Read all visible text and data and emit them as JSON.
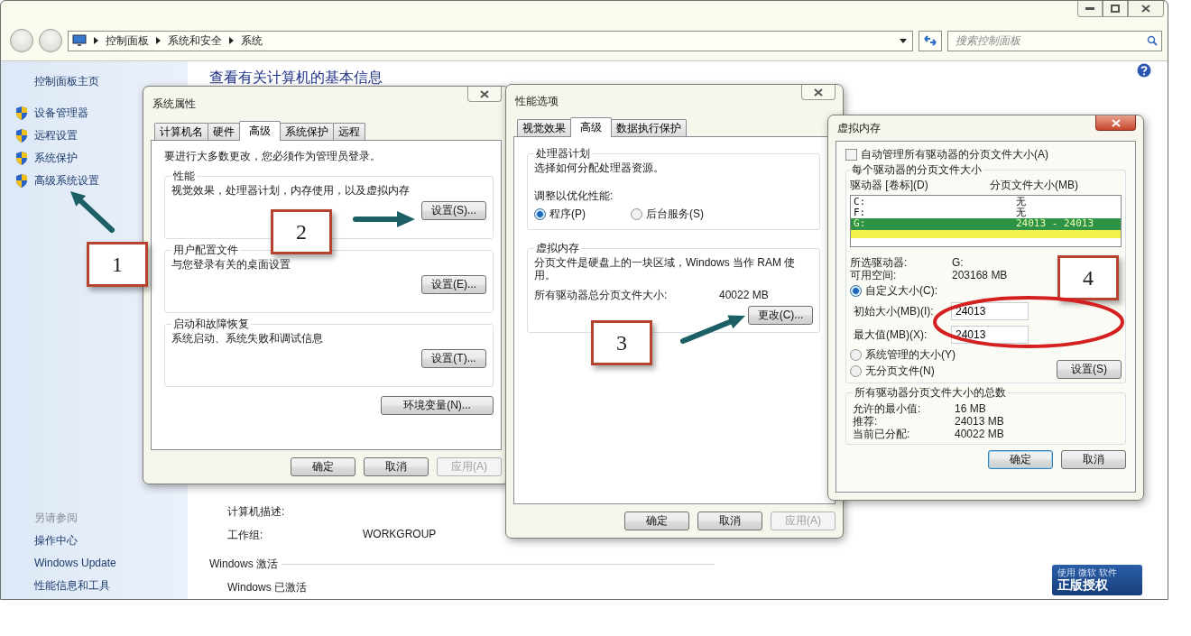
{
  "window": {
    "breadcrumbs": [
      "控制面板",
      "系统和安全",
      "系统"
    ],
    "search": {
      "placeholder": "搜索控制面板"
    }
  },
  "sidebar": {
    "home": "控制面板主页",
    "tasks": [
      "设备管理器",
      "远程设置",
      "系统保护",
      "高级系统设置"
    ],
    "see_also_title": "另请参阅",
    "see_also": [
      "操作中心",
      "Windows Update",
      "性能信息和工具"
    ]
  },
  "content": {
    "heading": "查看有关计算机的基本信息",
    "details": [
      {
        "label": "计算机描述:"
      },
      {
        "label": "工作组:",
        "value": "WORKGROUP"
      }
    ],
    "activation": {
      "title": "Windows 激活",
      "status": "Windows 已激活"
    },
    "genuine_badge": {
      "caption": "使用 微软 软件",
      "title": "正版授权"
    }
  },
  "system_properties": {
    "title": "系统属性",
    "tabs": [
      {
        "label": "计算机名",
        "selected": false
      },
      {
        "label": "硬件",
        "selected": false
      },
      {
        "label": "高级",
        "selected": true
      },
      {
        "label": "系统保护",
        "selected": false
      },
      {
        "label": "远程",
        "selected": false
      }
    ],
    "notice": "要进行大多数更改，您必须作为管理员登录。",
    "groups": [
      {
        "title": "性能",
        "description": "视觉效果，处理器计划，内存使用，以及虚拟内存",
        "button": "设置(S)..."
      },
      {
        "title": "用户配置文件",
        "description": "与您登录有关的桌面设置",
        "button": "设置(E)..."
      },
      {
        "title": "启动和故障恢复",
        "description": "系统启动、系统失败和调试信息",
        "button": "设置(T)..."
      }
    ],
    "env_button": "环境变量(N)...",
    "buttons": [
      {
        "label": "确定",
        "disabled": false
      },
      {
        "label": "取消",
        "disabled": false
      },
      {
        "label": "应用(A)",
        "disabled": true
      }
    ]
  },
  "performance_options": {
    "title": "性能选项",
    "tabs": [
      {
        "label": "视觉效果",
        "selected": false
      },
      {
        "label": "高级",
        "selected": true
      },
      {
        "label": "数据执行保护",
        "selected": false
      }
    ],
    "processor": {
      "title": "处理器计划",
      "description": "选择如何分配处理器资源。",
      "prompt": "调整以优化性能:",
      "options": [
        {
          "label": "程序(P)",
          "selected": true
        },
        {
          "label": "后台服务(S)",
          "selected": false
        }
      ]
    },
    "virtual_memory": {
      "title": "虚拟内存",
      "description": "分页文件是硬盘上的一块区域，Windows 当作 RAM 使用。",
      "total_label": "所有驱动器总分页文件大小:",
      "total_value": "40022 MB",
      "button": "更改(C)..."
    },
    "buttons": [
      {
        "label": "确定",
        "disabled": false
      },
      {
        "label": "取消",
        "disabled": false
      },
      {
        "label": "应用(A)",
        "disabled": true
      }
    ]
  },
  "virtual_memory": {
    "title": "虚拟内存",
    "auto_manage": {
      "label": "自动管理所有驱动器的分页文件大小(A)",
      "checked": false
    },
    "drives_group": "每个驱动器的分页文件大小",
    "columns": [
      "驱动器 [卷标](D)",
      "分页文件大小(MB)"
    ],
    "drives": [
      {
        "drive": "C:",
        "size": "无",
        "selected": false
      },
      {
        "drive": "F:",
        "size": "无",
        "selected": false
      },
      {
        "drive": "G:",
        "size": "24013 - 24013",
        "selected": true
      }
    ],
    "info": [
      {
        "label": "所选驱动器:",
        "value": "G:"
      },
      {
        "label": "可用空间:",
        "value": "203168 MB"
      }
    ],
    "modes": [
      {
        "label": "自定义大小(C):",
        "selected": true
      },
      {
        "label": "系统管理的大小(Y)",
        "selected": false
      },
      {
        "label": "无分页文件(N)",
        "selected": false
      }
    ],
    "fields": [
      {
        "label": "初始大小(MB)(I):",
        "value": "24013"
      },
      {
        "label": "最大值(MB)(X):",
        "value": "24013"
      }
    ],
    "set_button": "设置(S)",
    "totals_group": "所有驱动器分页文件大小的总数",
    "totals": [
      {
        "label": "允许的最小值:",
        "value": "16 MB"
      },
      {
        "label": "推荐:",
        "value": "24013 MB"
      },
      {
        "label": "当前已分配:",
        "value": "40022 MB"
      }
    ],
    "buttons": [
      {
        "label": "确定",
        "default": true
      },
      {
        "label": "取消",
        "default": false
      }
    ]
  },
  "callouts": [
    {
      "label": "1"
    },
    {
      "label": "2"
    },
    {
      "label": "3"
    },
    {
      "label": "4"
    }
  ]
}
